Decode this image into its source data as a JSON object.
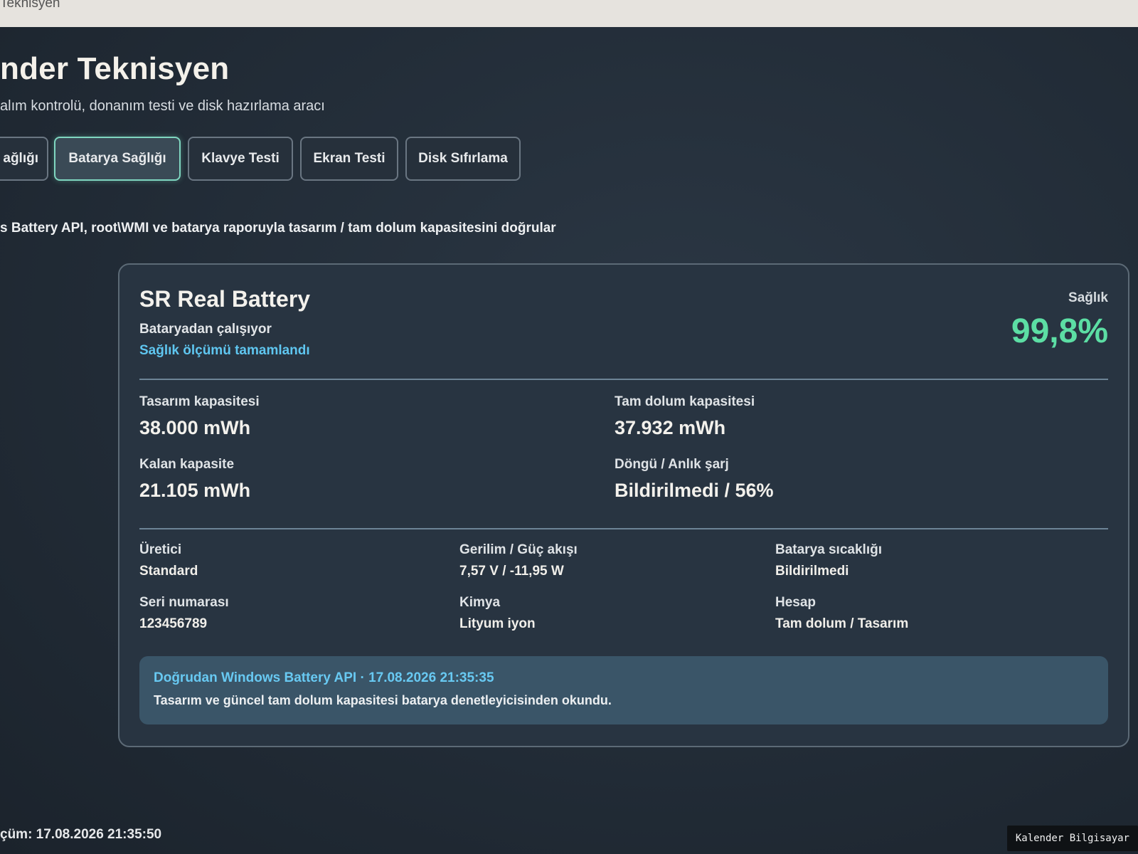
{
  "window": {
    "title": "Teknisyen"
  },
  "header": {
    "title": "nder Teknisyen",
    "subtitle": "alım kontrolü, donanım testi ve disk hazırlama aracı"
  },
  "tabs": [
    {
      "label": "ağlığı",
      "active": false
    },
    {
      "label": "Batarya Sağlığı",
      "active": true
    },
    {
      "label": "Klavye Testi",
      "active": false
    },
    {
      "label": "Ekran Testi",
      "active": false
    },
    {
      "label": "Disk Sıfırlama",
      "active": false
    }
  ],
  "description": "s Battery API, root\\WMI ve batarya raporuyla tasarım / tam dolum kapasitesini doğrular",
  "battery": {
    "name": "SR Real Battery",
    "status": "Bataryadan çalışıyor",
    "measurement_status": "Sağlık ölçümü tamamlandı",
    "health_label": "Sağlık",
    "health_value": "99,8%",
    "capacity": {
      "design_label": "Tasarım kapasitesi",
      "design_value": "38.000 mWh",
      "full_label": "Tam dolum kapasitesi",
      "full_value": "37.932 mWh",
      "remaining_label": "Kalan kapasite",
      "remaining_value": "21.105 mWh",
      "cycle_label": "Döngü / Anlık şarj",
      "cycle_value": "Bildirilmedi / 56%"
    },
    "info": {
      "manufacturer_label": "Üretici",
      "manufacturer_value": "Standard",
      "serial_label": "Seri numarası",
      "serial_value": "123456789",
      "voltage_label": "Gerilim / Güç akışı",
      "voltage_value": "7,57 V / -11,95 W",
      "chemistry_label": "Kimya",
      "chemistry_value": "Lityum iyon",
      "temp_label": "Batarya sıcaklığı",
      "temp_value": "Bildirilmedi",
      "calc_label": "Hesap",
      "calc_value": "Tam dolum / Tasarım"
    },
    "note": {
      "title": "Doğrudan Windows Battery API · 17.08.2026 21:35:35",
      "text": "Tasarım ve güncel tam dolum kapasitesi batarya denetleyicisinden okundu."
    }
  },
  "footer": {
    "last_measure": "çüm: 17.08.2026 21:35:50"
  },
  "watermark": "Kalender Bilgisayar",
  "colors": {
    "accent": "#5fc6f0",
    "health": "#5cdea4",
    "active_tab_border": "#7fd6c0",
    "note_bg": "#3a5568"
  }
}
